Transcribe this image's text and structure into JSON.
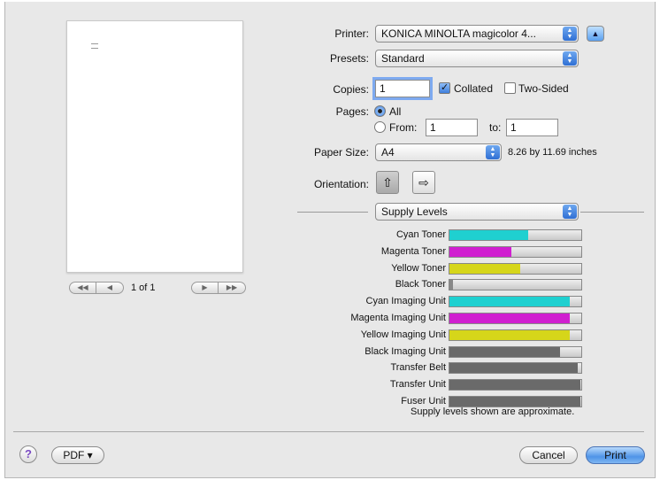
{
  "preview": {
    "page_count": "1 of 1"
  },
  "printer": {
    "label": "Printer:",
    "value": "KONICA MINOLTA magicolor 4..."
  },
  "presets": {
    "label": "Presets:",
    "value": "Standard"
  },
  "copies": {
    "label": "Copies:",
    "value": "1",
    "collated": "Collated",
    "collated_checked": true,
    "two_sided": "Two-Sided",
    "two_sided_checked": false
  },
  "pages": {
    "label": "Pages:",
    "all": "All",
    "from": "From:",
    "from_value": "1",
    "to": "to:",
    "to_value": "1"
  },
  "paper_size": {
    "label": "Paper Size:",
    "value": "A4",
    "dimensions": "8.26 by 11.69 inches"
  },
  "orientation": {
    "label": "Orientation:"
  },
  "panel_select": {
    "value": "Supply Levels"
  },
  "supplies": [
    {
      "label": "Cyan Toner",
      "level": 0.6,
      "color": "#1fd0d0"
    },
    {
      "label": "Magenta Toner",
      "level": 0.47,
      "color": "#d01fd0"
    },
    {
      "label": "Yellow Toner",
      "level": 0.54,
      "color": "#d6d61a"
    },
    {
      "label": "Black Toner",
      "level": 0.03,
      "color": "#888888"
    },
    {
      "label": "Cyan Imaging Unit",
      "level": 0.91,
      "color": "#1fd0d0"
    },
    {
      "label": "Magenta Imaging Unit",
      "level": 0.91,
      "color": "#d01fd0"
    },
    {
      "label": "Yellow Imaging Unit",
      "level": 0.91,
      "color": "#d6d61a"
    },
    {
      "label": "Black Imaging Unit",
      "level": 0.84,
      "color": "#6a6a6a"
    },
    {
      "label": "Transfer Belt",
      "level": 0.97,
      "color": "#6a6a6a"
    },
    {
      "label": "Transfer Unit",
      "level": 0.99,
      "color": "#6a6a6a"
    },
    {
      "label": "Fuser Unit",
      "level": 0.99,
      "color": "#6a6a6a"
    }
  ],
  "footnote": "Supply levels shown are approximate.",
  "buttons": {
    "help": "?",
    "pdf": "PDF ▾",
    "cancel": "Cancel",
    "print": "Print"
  }
}
